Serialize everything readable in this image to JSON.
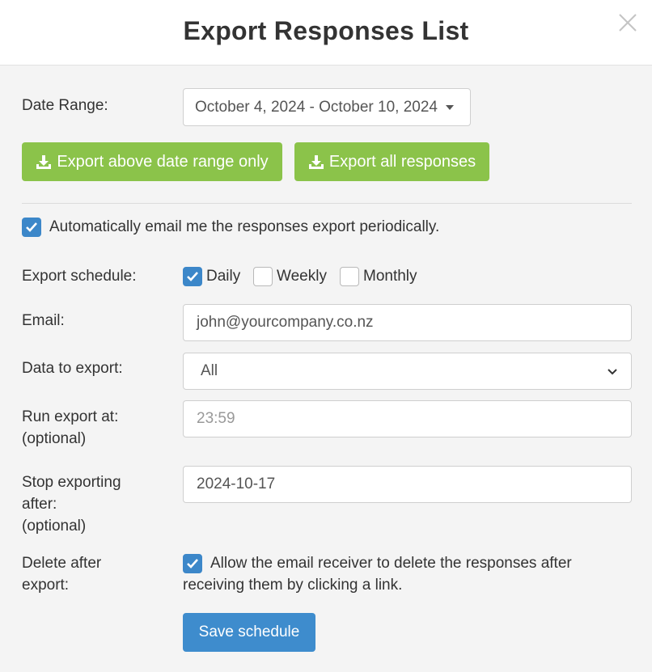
{
  "dialog": {
    "title": "Export Responses List",
    "close_icon": "close-icon"
  },
  "date_range": {
    "label": "Date Range:",
    "value": "October 4, 2024 - October 10, 2024"
  },
  "buttons": {
    "export_range": "Export above date range only",
    "export_all": "Export all responses",
    "save_schedule": "Save schedule"
  },
  "auto_email": {
    "checked": true,
    "label": "Automatically email me the responses export periodically."
  },
  "schedule": {
    "label": "Export schedule:",
    "options": [
      {
        "label": "Daily",
        "checked": true
      },
      {
        "label": "Weekly",
        "checked": false
      },
      {
        "label": "Monthly",
        "checked": false
      }
    ]
  },
  "email": {
    "label": "Email:",
    "value": "john@yourcompany.co.nz"
  },
  "data_export": {
    "label": "Data to export:",
    "value": "All"
  },
  "run_export": {
    "label_line1": "Run export at:",
    "label_line2": "(optional)",
    "placeholder": "23:59"
  },
  "stop_export": {
    "label_line1": "Stop exporting",
    "label_line2": "after:",
    "label_line3": "(optional)",
    "value": "2024-10-17"
  },
  "delete_after": {
    "label_line1": "Delete after",
    "label_line2": "export:",
    "checked": true,
    "text_line1": "Allow the email receiver to delete the responses after",
    "text_line2": "receiving them by clicking a link."
  },
  "colors": {
    "green": "#8bc34a",
    "blue": "#3e8ccd",
    "checkbox": "#3c87c9"
  }
}
